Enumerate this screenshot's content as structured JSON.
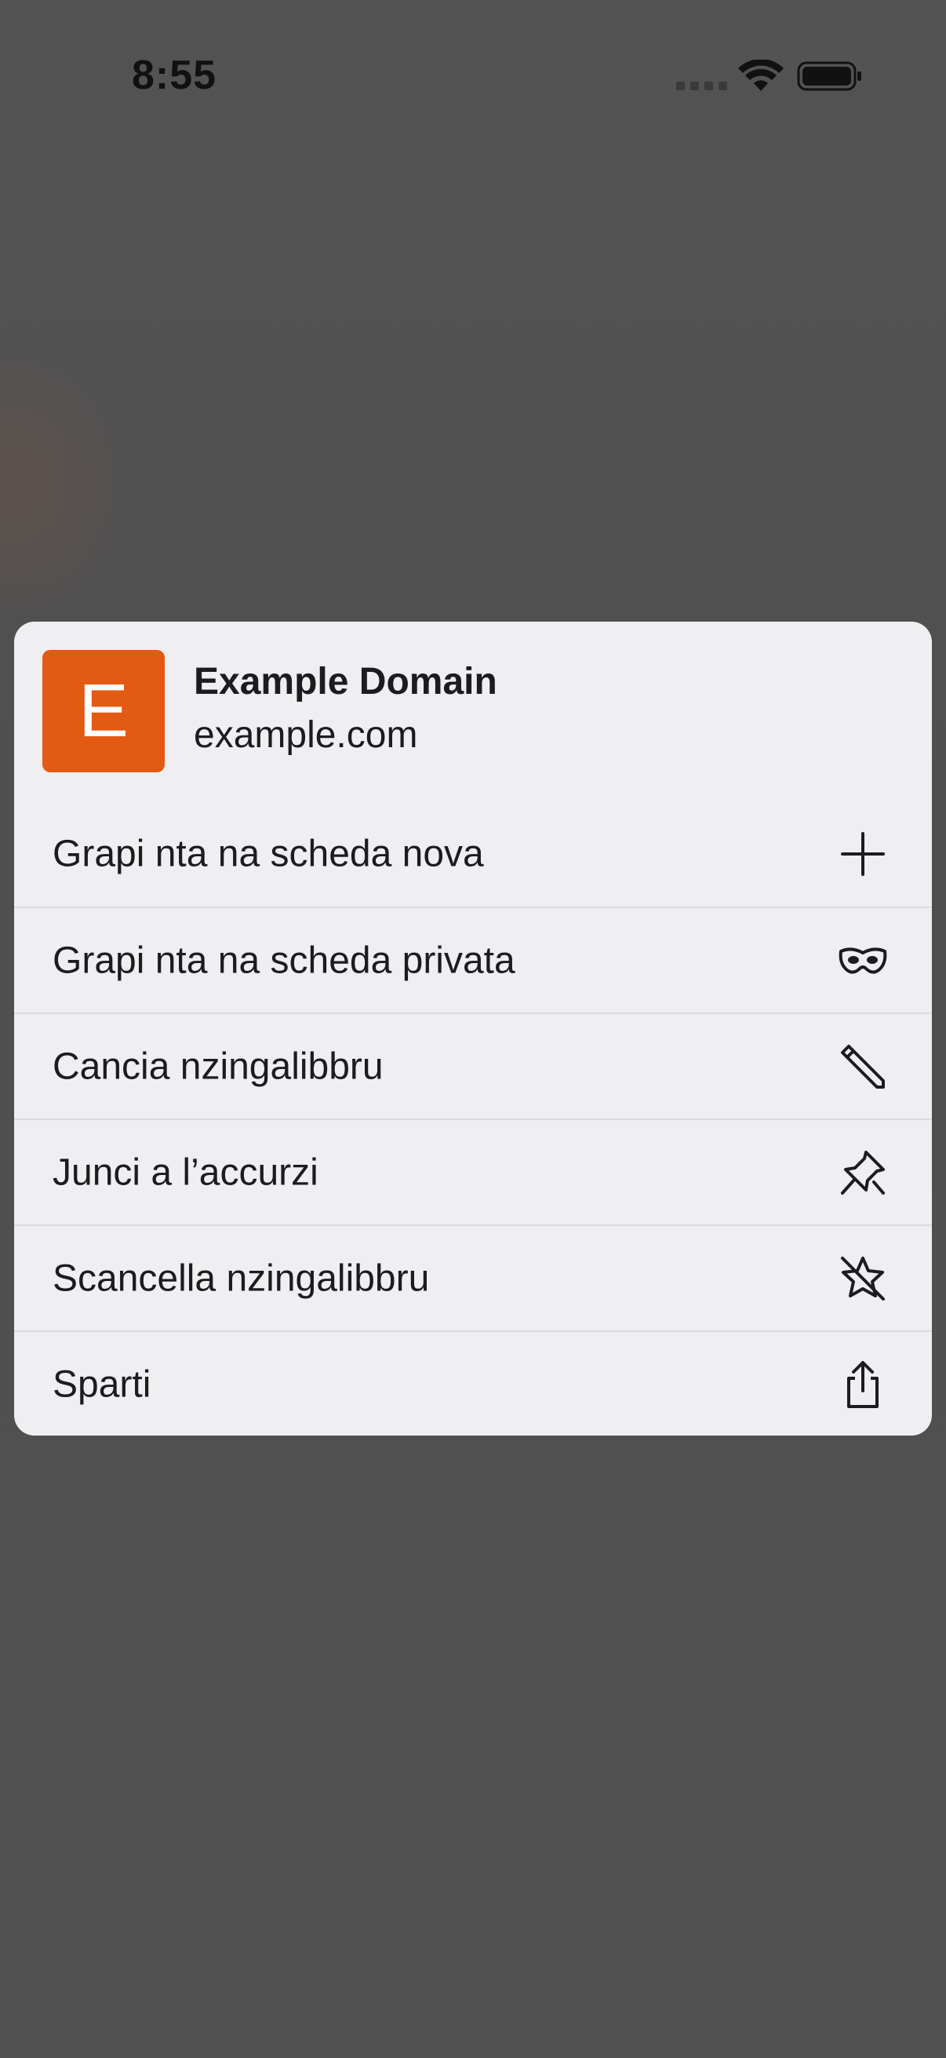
{
  "status_bar": {
    "time": "8:55"
  },
  "preview": {
    "favicon_letter": "E",
    "favicon_color": "#e35b12",
    "title": "Example Domain",
    "url": "example.com"
  },
  "menu": {
    "items": [
      {
        "label": "Grapi nta na scheda nova",
        "icon": "plus-icon"
      },
      {
        "label": "Grapi nta na scheda privata",
        "icon": "private-mask-icon"
      },
      {
        "label": "Cancia nzingalibbru",
        "icon": "pencil-icon"
      },
      {
        "label": "Junci a l’accurzi",
        "icon": "pin-icon"
      },
      {
        "label": "Scancella nzingalibbru",
        "icon": "bookmark-remove-icon"
      },
      {
        "label": "Sparti",
        "icon": "share-icon"
      }
    ]
  }
}
